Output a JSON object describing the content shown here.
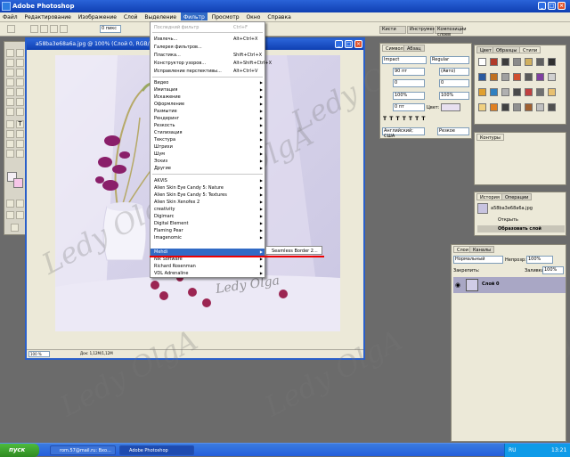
{
  "app": {
    "title": "Adobe Photoshop"
  },
  "menubar": {
    "items": [
      "Файл",
      "Редактирование",
      "Изображение",
      "Слой",
      "Выделение",
      "Фильтр",
      "Просмотр",
      "Окно",
      "Справка"
    ],
    "active": "Фильтр"
  },
  "options": {
    "feather": "0 пикс",
    "brushes_tab": "Кисти",
    "presets_tab": "Инструменты",
    "comps_tab": "Композиции слоев"
  },
  "document": {
    "title": "a58ba3e68a6a.jpg @ 100% (Слой 0, RGB/8)",
    "zoom": "100 %",
    "doc_size": "Док: 1,12M/1,12M",
    "watermark": "Ledy OlgA",
    "signature": "Ledy Olga"
  },
  "filter_menu": {
    "group1": [
      {
        "label": "Последний фильтр",
        "shortcut": "Ctrl+F",
        "disabled": true
      },
      {
        "label": "Извлечь...",
        "shortcut": "Alt+Ctrl+X"
      },
      {
        "label": "Галерея фильтров...",
        "shortcut": ""
      },
      {
        "label": "Пластика...",
        "shortcut": "Shift+Ctrl+X"
      },
      {
        "label": "Конструктор узоров...",
        "shortcut": "Alt+Shift+Ctrl+X"
      },
      {
        "label": "Исправление перспективы...",
        "shortcut": "Alt+Ctrl+V"
      }
    ],
    "group2": [
      "Видео",
      "Имитация",
      "Искажение",
      "Оформление",
      "Размытие",
      "Рендеринг",
      "Резкость",
      "Стилизация",
      "Текстура",
      "Штрихи",
      "Шум",
      "Эскиз",
      "Другие"
    ],
    "group3": [
      "AKVIS",
      "Alien Skin Eye Candy 5: Nature",
      "Alien Skin Eye Candy 5: Textures",
      "Alien Skin Xenofex 2",
      "creativity",
      "Digimarc",
      "Digital Element",
      "Flaming Pear",
      "Imagenomic",
      "Mehdi",
      "Nik Software",
      "Richard Rosenman",
      "VDL Adrenaline"
    ],
    "highlighted": "Mehdi",
    "submenu_item": "Seamless Border 2..."
  },
  "char_panel": {
    "tabs": [
      "Символ",
      "Абзац"
    ],
    "font": "Impact",
    "style": "Regular",
    "size": "90 пт",
    "leading": "(Авто)",
    "kerning": "0",
    "tracking": "0",
    "vscale": "100%",
    "hscale": "100%",
    "baseline": "0 пт",
    "color_label": "Цвет:",
    "language": "Английский; США",
    "aa": "Резкое"
  },
  "styles_panel": {
    "tabs": [
      "Цвет",
      "Образцы",
      "Стили"
    ]
  },
  "paths_panel": {
    "tab": "Контуры"
  },
  "history_panel": {
    "tabs": [
      "История",
      "Операции"
    ],
    "snapshot": "a58ba3e68a6a.jpg",
    "items": [
      "Открыть",
      "Образовать слой"
    ]
  },
  "layers_panel": {
    "tabs": [
      "Слои",
      "Каналы"
    ],
    "blend": "Нормальный",
    "opacity_label": "Непрозр:",
    "opacity": "100%",
    "lock_label": "Закрепить:",
    "fill_label": "Заливка:",
    "fill": "100%",
    "layer_name": "Слой 0"
  },
  "taskbar": {
    "start": "пуск",
    "tasks": [
      "rom.57@mail.ru: Вхо...",
      "Adobe Photoshop"
    ],
    "lang": "RU",
    "clock": "13:21"
  },
  "colors": {
    "accent": "#316ac5",
    "title": "#0f3fb2",
    "underline": "#e00000"
  }
}
